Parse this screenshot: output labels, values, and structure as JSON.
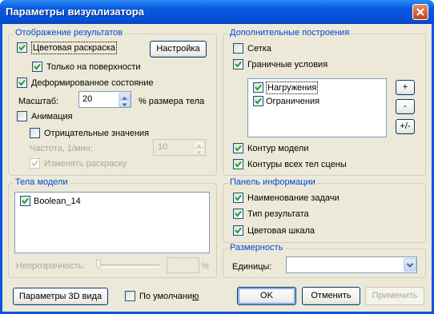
{
  "window": {
    "title": "Параметры визуализатора"
  },
  "results_group": {
    "title": "Отображение результатов",
    "color_map": "Цветовая раскраска",
    "settings_button": "Настройка",
    "surface_only": "Только на поверхности",
    "deformed": "Деформированное состояние",
    "scale_label": "Масштаб:",
    "scale_value": "20",
    "scale_suffix": "% размера тела",
    "animation": "Анимация",
    "negative_values": "Отрицательные значения",
    "frequency_label": "Частота, 1/мин:",
    "frequency_value": "10",
    "change_coloring": "Изменять раскраску"
  },
  "extra_group": {
    "title": "Дополнительные построения",
    "grid": "Сетка",
    "boundary": "Граничные условия",
    "loads": "Нагружения",
    "constraints": "Ограничения",
    "plus_button": "+",
    "minus_button": "-",
    "plusminus_button": "+/-",
    "model_contour": "Контур модели",
    "scene_contours": "Контуры всех тел сцены"
  },
  "bodies_group": {
    "title": "Тела модели",
    "items": [
      "Boolean_14"
    ],
    "opacity_label": "Непрозрачность:",
    "opacity_value": "",
    "percent": "%"
  },
  "info_group": {
    "title": "Панель информации",
    "task_name": "Наименование задачи",
    "result_type": "Тип результата",
    "color_scale": "Цветовая шкала"
  },
  "dimension_group": {
    "title": "Размерность",
    "units_label": "Единицы:",
    "units_value": ""
  },
  "footer": {
    "view3d_button": "Параметры 3D вида",
    "default_prefix": "По умолчани",
    "default_underlined": "ю",
    "ok_button": "OK",
    "cancel_button": "Отменить",
    "apply_button": "Применить"
  },
  "colors": {
    "title_bar": "#0a55e1",
    "dialog_bg": "#ece9d8",
    "group_title": "#0046d5",
    "check_green": "#21a121",
    "close_red": "#c2461d"
  }
}
